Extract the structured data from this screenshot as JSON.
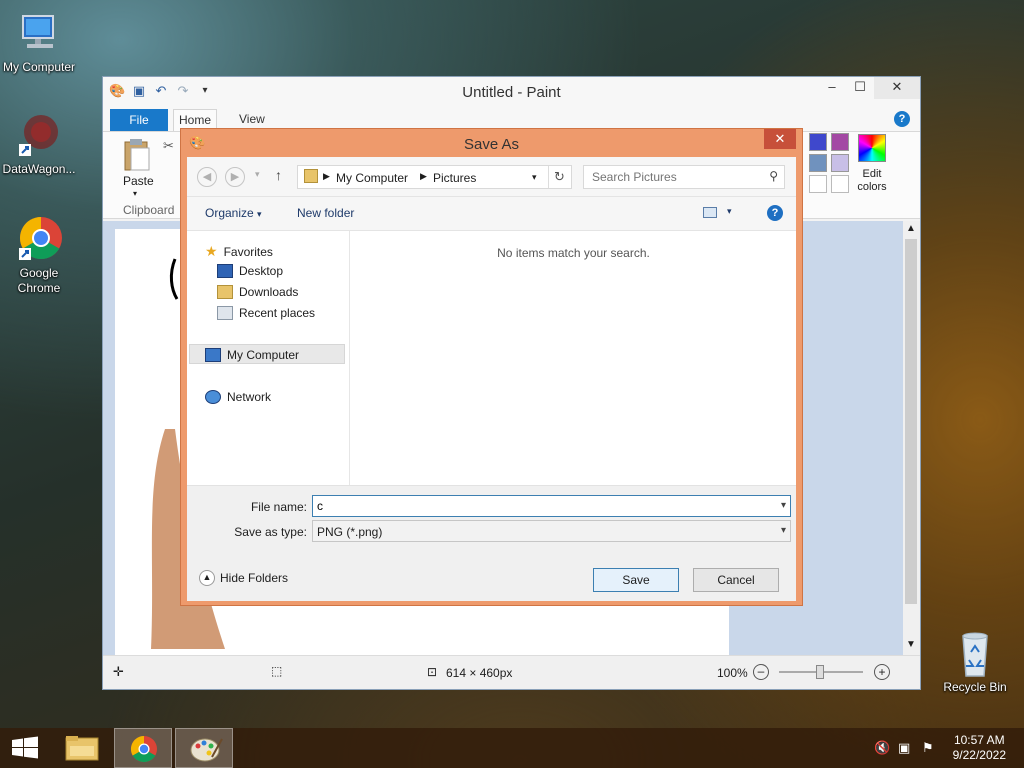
{
  "desktop": {
    "icons": [
      {
        "label": "My Computer"
      },
      {
        "label": "DataWagon..."
      },
      {
        "label": "Google Chrome"
      },
      {
        "label": "Recycle Bin"
      }
    ]
  },
  "paint": {
    "title": "Untitled - Paint",
    "tabs": {
      "file": "File",
      "home": "Home",
      "view": "View"
    },
    "ribbon": {
      "paste": "Paste",
      "clipboard": "Clipboard",
      "edit_colors": "Edit colors"
    },
    "status": {
      "size": "614 × 460px",
      "zoom": "100%"
    }
  },
  "dialog": {
    "title": "Save As",
    "address": {
      "root": "My Computer",
      "folder": "Pictures"
    },
    "search_placeholder": "Search Pictures",
    "toolbar": {
      "organize": "Organize",
      "new_folder": "New folder"
    },
    "nav": {
      "favorites": "Favorites",
      "desktop": "Desktop",
      "downloads": "Downloads",
      "recent": "Recent places",
      "computer": "My Computer",
      "network": "Network"
    },
    "empty_message": "No items match your search.",
    "file_name_label": "File name:",
    "file_name_value": "c",
    "save_type_label": "Save as type:",
    "save_type_value": "PNG (*.png)",
    "hide_folders": "Hide Folders",
    "save": "Save",
    "cancel": "Cancel"
  },
  "taskbar": {
    "time": "10:57 AM",
    "date": "9/22/2022"
  }
}
